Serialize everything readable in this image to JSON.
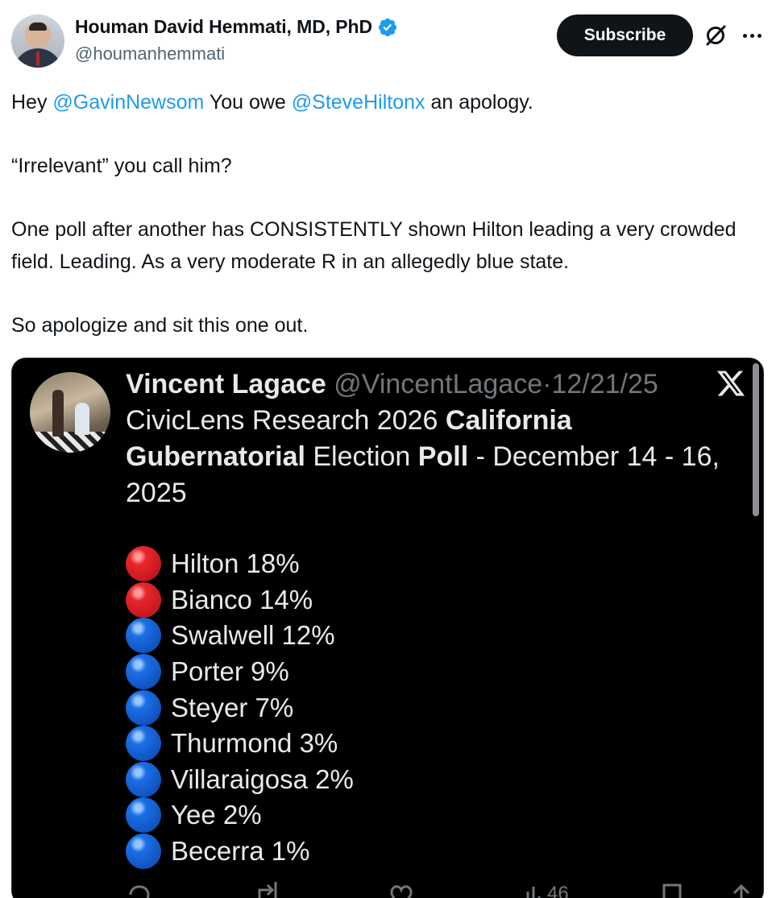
{
  "author": {
    "display_name": "Houman David Hemmati, MD, PhD",
    "handle": "@houmanhemmati",
    "verified": true
  },
  "header": {
    "subscribe_label": "Subscribe",
    "icons": [
      "grok-icon",
      "more-icon"
    ]
  },
  "tweet": {
    "line1_prefix": "Hey ",
    "line1_mention1": "@GavinNewsom",
    "line1_middle": " You owe ",
    "line1_mention2": "@SteveHiltonx",
    "line1_suffix": " an apology.",
    "line2": "“Irrelevant” you call him?",
    "line3": "One poll after another has CONSISTENTLY shown Hilton leading a very crowded field. Leading. As a very moderate R in an allegedly blue state.",
    "line4": "So apologize and sit this one out."
  },
  "embedded_post": {
    "name": "Vincent Lagace",
    "handle": "@VincentLagace",
    "separator": "·",
    "date": "12/21/25",
    "text_1": "CivicLens Research 2026 ",
    "text_bold1": "California Gubernatorial",
    "text_2": " Election ",
    "text_bold2": "Poll",
    "text_3": " - December 14 - 16, 2025",
    "poll": [
      {
        "candidate": "Hilton 18%",
        "party_color": "#e8262b"
      },
      {
        "candidate": "Bianco 14%",
        "party_color": "#e8262b"
      },
      {
        "candidate": "Swalwell 12%",
        "party_color": "#1a6fe6"
      },
      {
        "candidate": "Porter 9%",
        "party_color": "#1a6fe6"
      },
      {
        "candidate": "Steyer 7%",
        "party_color": "#1a6fe6"
      },
      {
        "candidate": "Thurmond 3%",
        "party_color": "#1a6fe6"
      },
      {
        "candidate": "Villaraigosa 2%",
        "party_color": "#1a6fe6"
      },
      {
        "candidate": "Yee 2%",
        "party_color": "#1a6fe6"
      },
      {
        "candidate": "Becerra 1%",
        "party_color": "#1a6fe6"
      }
    ],
    "views_count": "46"
  },
  "colors": {
    "link": "#1d9bf0",
    "text": "#0f1419",
    "secondary": "#536471",
    "embed_bg": "#000000",
    "red_party": "#e8262b",
    "blue_party": "#1a6fe6"
  }
}
